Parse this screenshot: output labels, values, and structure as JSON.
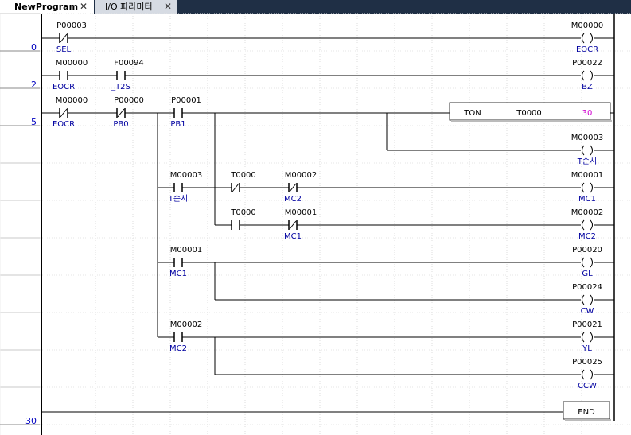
{
  "tabs": [
    {
      "label": "NewProgram",
      "active": true
    },
    {
      "label": "I/O 파라미터",
      "active": false
    }
  ],
  "rung_numbers": [
    {
      "row": 1,
      "label": "0"
    },
    {
      "row": 2,
      "label": "2"
    },
    {
      "row": 3,
      "label": "5"
    },
    {
      "row": 11,
      "label": "30"
    }
  ],
  "ladder": {
    "contacts": [
      {
        "row": 1,
        "col": 1,
        "address": "P00003",
        "comment": "SEL",
        "type": "NC"
      },
      {
        "row": 2,
        "col": 1,
        "address": "M00000",
        "comment": "EOCR",
        "type": "NO"
      },
      {
        "row": 2,
        "col": 2,
        "address": "F00094",
        "comment": "_T2S",
        "type": "NO"
      },
      {
        "row": 3,
        "col": 1,
        "address": "M00000",
        "comment": "EOCR",
        "type": "NC"
      },
      {
        "row": 3,
        "col": 2,
        "address": "P00000",
        "comment": "PB0",
        "type": "NC"
      },
      {
        "row": 3,
        "col": 3,
        "address": "P00001",
        "comment": "PB1",
        "type": "NO"
      },
      {
        "row": 5,
        "col": 3,
        "address": "M00003",
        "comment": "T순시",
        "type": "NO"
      },
      {
        "row": 5,
        "col": 4,
        "address": "T0000",
        "comment": "",
        "type": "NC"
      },
      {
        "row": 5,
        "col": 5,
        "address": "M00002",
        "comment": "MC2",
        "type": "NC"
      },
      {
        "row": 6,
        "col": 4,
        "address": "T0000",
        "comment": "",
        "type": "NO"
      },
      {
        "row": 6,
        "col": 5,
        "address": "M00001",
        "comment": "MC1",
        "type": "NC"
      },
      {
        "row": 7,
        "col": 3,
        "address": "M00001",
        "comment": "MC1",
        "type": "NO"
      },
      {
        "row": 9,
        "col": 3,
        "address": "M00002",
        "comment": "MC2",
        "type": "NO"
      }
    ],
    "coils": [
      {
        "row": 1,
        "address": "M00000",
        "comment": "EOCR"
      },
      {
        "row": 2,
        "address": "P00022",
        "comment": "BZ"
      },
      {
        "row": 4,
        "address": "M00003",
        "comment": "T순시"
      },
      {
        "row": 5,
        "address": "M00001",
        "comment": "MC1"
      },
      {
        "row": 6,
        "address": "M00002",
        "comment": "MC2"
      },
      {
        "row": 7,
        "address": "P00020",
        "comment": "GL"
      },
      {
        "row": 8,
        "address": "P00024",
        "comment": "CW"
      },
      {
        "row": 9,
        "address": "P00021",
        "comment": "YL"
      },
      {
        "row": 10,
        "address": "P00025",
        "comment": "CCW"
      }
    ],
    "timer": {
      "row": 3,
      "instruction": "TON",
      "address": "T0000",
      "preset": "30"
    },
    "end_block": {
      "row": 11,
      "label": "END"
    }
  },
  "colors": {
    "address": "#000000",
    "comment": "#0000a0",
    "preset": "#d000d0",
    "rung_number": "#0000c0",
    "grid": "#c8c8c8"
  }
}
